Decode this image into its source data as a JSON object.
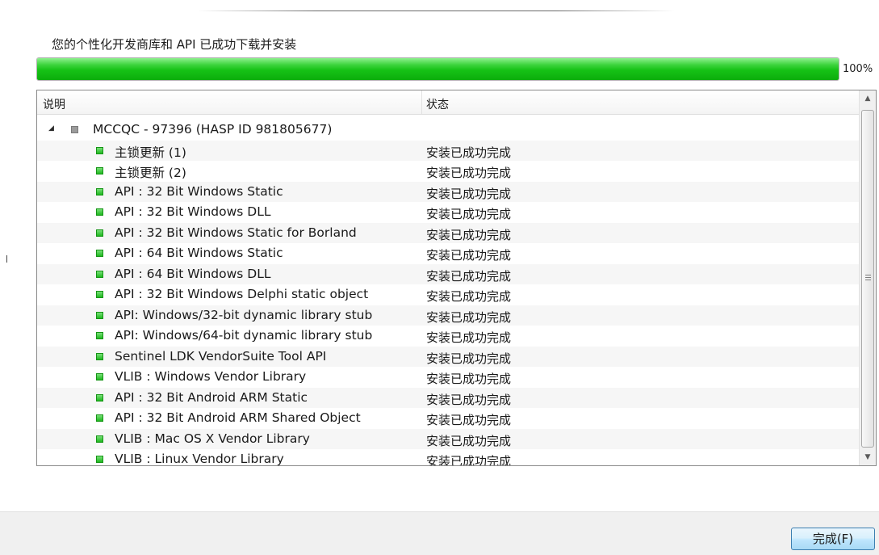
{
  "heading": "您的个性化开发商库和 API 已成功下载并安装",
  "progress": {
    "value": 1.0,
    "label": "100%"
  },
  "list": {
    "columns": {
      "description": "说明",
      "status": "状态"
    },
    "root": {
      "label": "MCCQC - 97396 (HASP ID 981805677)"
    },
    "items": [
      {
        "label": "主锁更新 (1)",
        "status": "安装已成功完成"
      },
      {
        "label": "主锁更新 (2)",
        "status": "安装已成功完成"
      },
      {
        "label": "API : 32 Bit Windows Static",
        "status": "安装已成功完成"
      },
      {
        "label": "API : 32 Bit Windows DLL",
        "status": "安装已成功完成"
      },
      {
        "label": "API : 32 Bit Windows Static for Borland",
        "status": "安装已成功完成"
      },
      {
        "label": "API : 64 Bit Windows Static",
        "status": "安装已成功完成"
      },
      {
        "label": "API : 64 Bit Windows DLL",
        "status": "安装已成功完成"
      },
      {
        "label": "API : 32 Bit Windows Delphi static object",
        "status": "安装已成功完成"
      },
      {
        "label": "API:  Windows/32-bit dynamic library stub",
        "status": "安装已成功完成"
      },
      {
        "label": "API:  Windows/64-bit dynamic library stub",
        "status": "安装已成功完成"
      },
      {
        "label": "Sentinel LDK VendorSuite Tool API",
        "status": "安装已成功完成"
      },
      {
        "label": "VLIB : Windows Vendor Library",
        "status": "安装已成功完成"
      },
      {
        "label": "API : 32 Bit Android ARM Static",
        "status": "安装已成功完成"
      },
      {
        "label": "API : 32 Bit Android ARM Shared Object",
        "status": "安装已成功完成"
      },
      {
        "label": "VLIB : Mac OS X Vendor Library",
        "status": "安装已成功完成"
      },
      {
        "label": "VLIB : Linux Vendor Library",
        "status": "安装已成功完成"
      }
    ]
  },
  "footer": {
    "finish_label": "完成(F)"
  },
  "colors": {
    "progress_green": "#16c216",
    "button_border": "#3c7fb1"
  }
}
